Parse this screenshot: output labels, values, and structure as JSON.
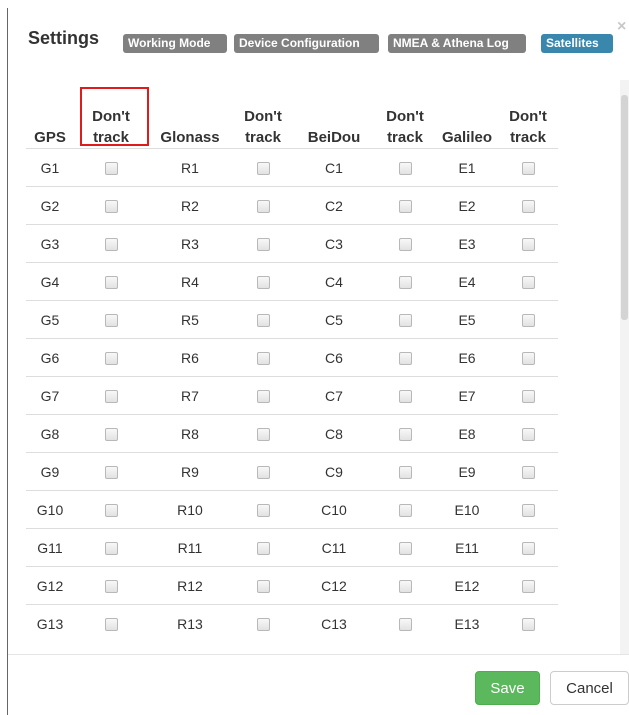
{
  "dialog": {
    "title": "Settings",
    "close_symbol": "×",
    "tabs": [
      {
        "label": "Working Mode",
        "active": false
      },
      {
        "label": "Device Configuration",
        "active": false
      },
      {
        "label": "NMEA & Athena Log",
        "active": false
      },
      {
        "label": "Satellites",
        "active": true
      }
    ]
  },
  "table": {
    "headers": [
      "GPS",
      "Don't track",
      "Glonass",
      "Don't track",
      "BeiDou",
      "Don't track",
      "Galileo",
      "Don't track"
    ],
    "rows": [
      {
        "gps": "G1",
        "glonass": "R1",
        "beidou": "C1",
        "galileo": "E1"
      },
      {
        "gps": "G2",
        "glonass": "R2",
        "beidou": "C2",
        "galileo": "E2"
      },
      {
        "gps": "G3",
        "glonass": "R3",
        "beidou": "C3",
        "galileo": "E3"
      },
      {
        "gps": "G4",
        "glonass": "R4",
        "beidou": "C4",
        "galileo": "E4"
      },
      {
        "gps": "G5",
        "glonass": "R5",
        "beidou": "C5",
        "galileo": "E5"
      },
      {
        "gps": "G6",
        "glonass": "R6",
        "beidou": "C6",
        "galileo": "E6"
      },
      {
        "gps": "G7",
        "glonass": "R7",
        "beidou": "C7",
        "galileo": "E7"
      },
      {
        "gps": "G8",
        "glonass": "R8",
        "beidou": "C8",
        "galileo": "E8"
      },
      {
        "gps": "G9",
        "glonass": "R9",
        "beidou": "C9",
        "galileo": "E9"
      },
      {
        "gps": "G10",
        "glonass": "R10",
        "beidou": "C10",
        "galileo": "E10"
      },
      {
        "gps": "G11",
        "glonass": "R11",
        "beidou": "C11",
        "galileo": "E11"
      },
      {
        "gps": "G12",
        "glonass": "R12",
        "beidou": "C12",
        "galileo": "E12"
      },
      {
        "gps": "G13",
        "glonass": "R13",
        "beidou": "C13",
        "galileo": "E13"
      }
    ]
  },
  "footer": {
    "save_label": "Save",
    "cancel_label": "Cancel"
  },
  "colors": {
    "tab_default": "#808080",
    "tab_active": "#3a87ad",
    "save_button": "#5cb85c",
    "highlight_border": "#e11b1b"
  }
}
